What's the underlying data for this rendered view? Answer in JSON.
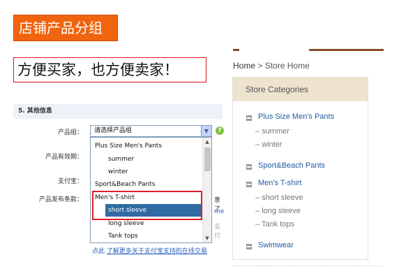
{
  "title_banner": "店铺产品分组",
  "slogan": "方便买家，也方便卖家！",
  "form": {
    "section_header": "5. 其他信息",
    "labels": {
      "product_group": "产品组：",
      "validity": "产品有效期：",
      "alipay": "支付宝：",
      "terms": "产品发布条款："
    },
    "select_value": "请选择产品组",
    "help_icon": "?",
    "dropdown_options": [
      {
        "label": "Plus Size Men's Pants",
        "level": 0
      },
      {
        "label": "summer",
        "level": 1
      },
      {
        "label": "winter",
        "level": 1
      },
      {
        "label": "Sport&Beach Pants",
        "level": 0
      },
      {
        "label": "Men's T-shirt",
        "level": 0
      },
      {
        "label": "short sleeve",
        "level": 1,
        "selected": true
      },
      {
        "label": "long sleeve",
        "level": 1
      },
      {
        "label": "Tank tops",
        "level": 1
      }
    ],
    "cut_text": {
      "line1": "意了",
      "line2": "me",
      "line3": "支付"
    },
    "footer_link_prefix": "点此",
    "footer_link_text": "了解更多关于支付宝支持的在线交易"
  },
  "store": {
    "breadcrumb_home": "Home",
    "breadcrumb_sep": ">",
    "breadcrumb_current": "Store Home",
    "header": "Store Categories",
    "categories": [
      {
        "label": "Plus Size Men's Pants",
        "children": [
          "summer",
          "winter"
        ]
      },
      {
        "label": "Sport&Beach Pants",
        "children": []
      },
      {
        "label": "Men's T-shirt",
        "children": [
          "short sleeve",
          "long sleeve",
          "Tank tops"
        ]
      },
      {
        "label": "Swimwear",
        "children": []
      }
    ]
  },
  "colors": {
    "banner_orange": "#f0640f",
    "slogan_border": "#d9141b",
    "selection_blue": "#306aa2",
    "highlight_red": "#e01d2c",
    "store_header_bg": "#ede3cf",
    "category_link": "#1f5a9e"
  }
}
